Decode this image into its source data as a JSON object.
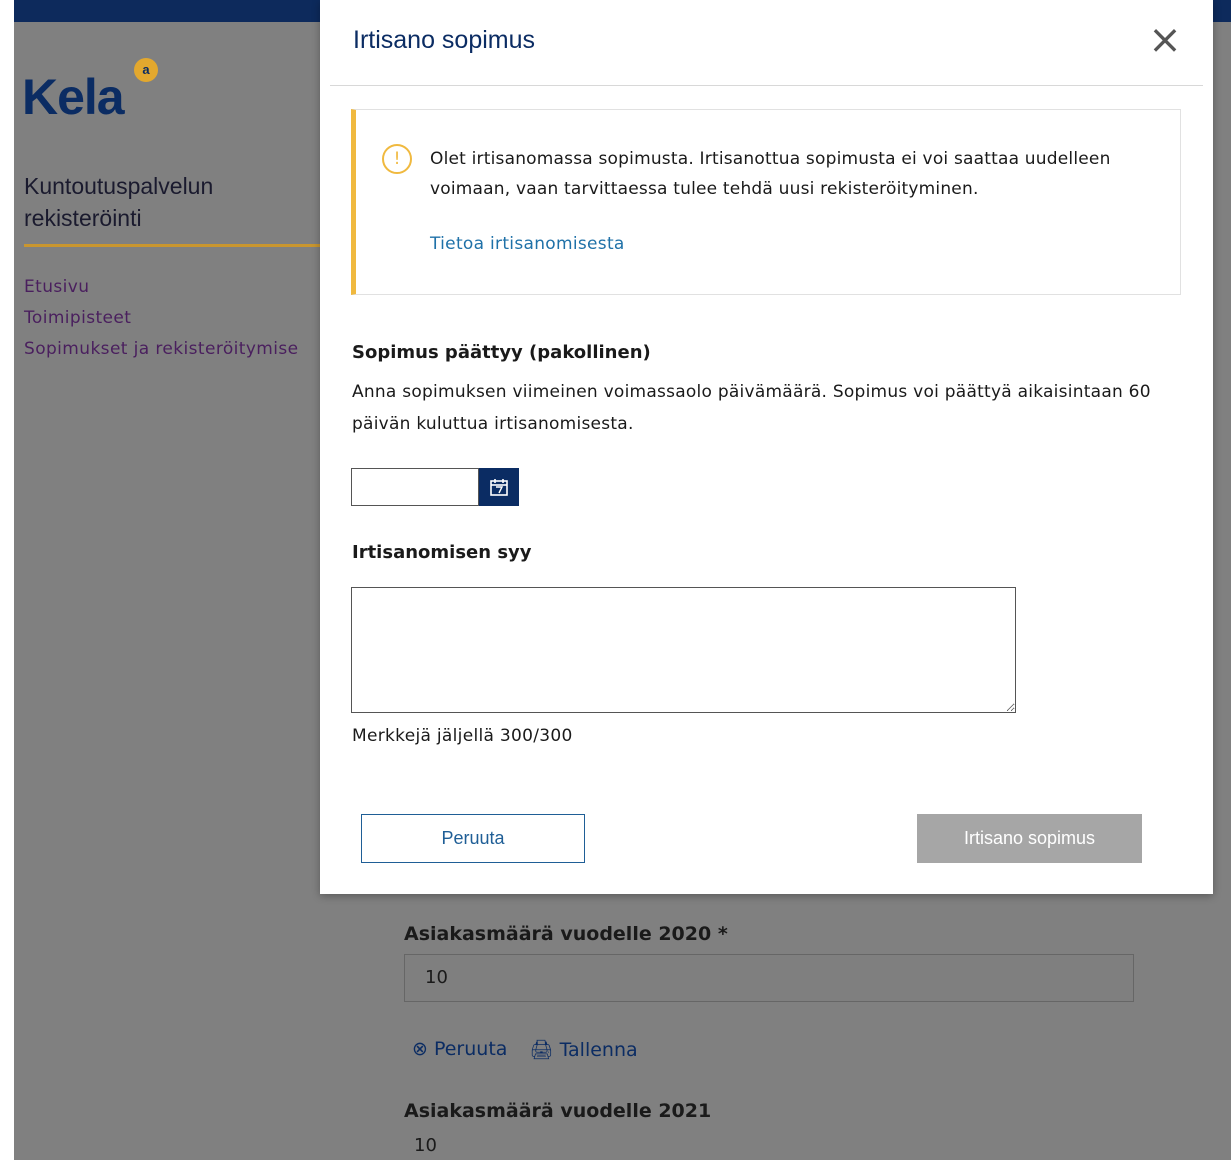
{
  "background": {
    "logo": "Kela",
    "logo_mark": "a",
    "app_title": "Kuntoutuspalvelun rekisteröinti",
    "nav": [
      "Etusivu",
      "Toimipisteet",
      "Sopimukset ja rekisteröitymise"
    ],
    "content": {
      "label_2020": "Asiakasmäärä vuodelle 2020 *",
      "value_2020": "10",
      "cancel_action": "⊗ Peruuta",
      "save_action": "🖨 Tallenna",
      "label_2021": "Asiakasmäärä vuodelle 2021",
      "value_2021": "10"
    }
  },
  "modal": {
    "title": "Irtisano sopimus",
    "close_icon": "×",
    "alert": {
      "icon": "!",
      "text": "Olet irtisanomassa sopimusta. Irtisanottua sopimusta ei voi saattaa uudelleen voimaan, vaan tarvittaessa tulee tehdä uusi rekisteröityminen.",
      "link": "Tietoa irtisanomisesta",
      "accent_color": "#f0b93f"
    },
    "end_date": {
      "label": "Sopimus päättyy (pakollinen)",
      "help": "Anna sopimuksen viimeinen voimassaolo päivämäärä. Sopimus voi päättyä aikaisintaan 60 päivän kuluttua irtisanomisesta.",
      "value": "",
      "calendar_icon": "calendar-icon"
    },
    "reason": {
      "label": "Irtisanomisen syy",
      "value": "",
      "counter": "Merkkejä jäljellä 300/300"
    },
    "buttons": {
      "cancel": "Peruuta",
      "submit": "Irtisano sopimus"
    }
  }
}
